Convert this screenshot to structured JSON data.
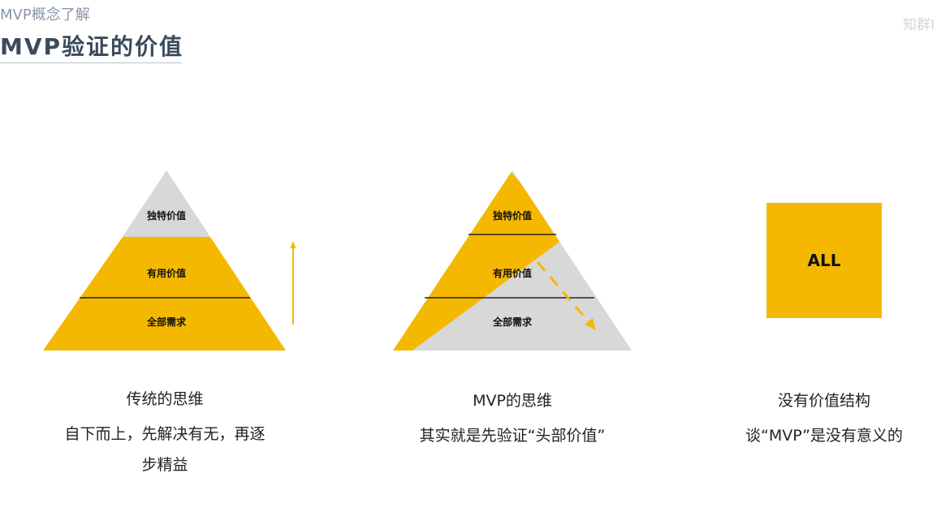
{
  "header": {
    "breadcrumb": "MVP概念了解",
    "title": "MVP验证的价值",
    "watermark": "知群Ⅰ"
  },
  "colors": {
    "accent": "#f5b800",
    "gray": "#d8d8d8",
    "title": "#3b4a5c",
    "breadcrumb": "#8a97a8"
  },
  "panels": [
    {
      "tiers": [
        "独特价值",
        "有用价值",
        "全部需求"
      ],
      "caption_title": "传统的思维",
      "caption_line1": "自下而上，先解决有无，再逐",
      "caption_line2": "步精益"
    },
    {
      "tiers": [
        "独特价值",
        "有用价值",
        "全部需求"
      ],
      "caption_title": "MVP的思维",
      "caption_line1": "其实就是先验证“头部价值”"
    },
    {
      "box_label": "ALL",
      "caption_title": "没有价值结构",
      "caption_line1": "谈“MVP”是没有意义的"
    }
  ]
}
